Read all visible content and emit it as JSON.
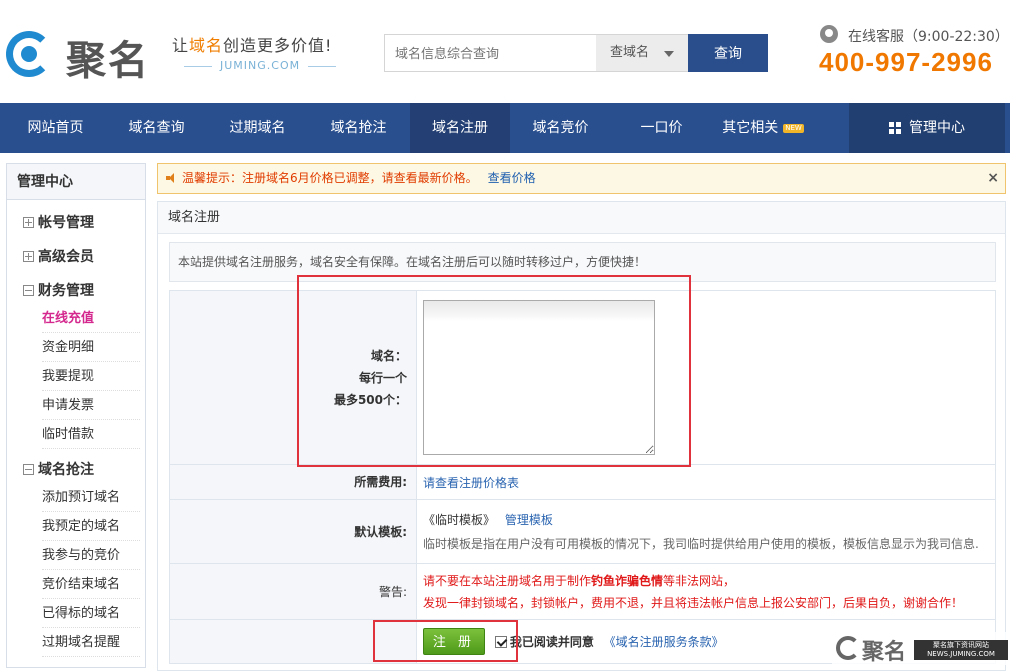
{
  "header": {
    "logo_text": "聚名",
    "slogan_prefix": "让",
    "slogan_highlight": "域名",
    "slogan_suffix": "创造更多价值!",
    "site": "JUMING.COM",
    "search_placeholder": "域名信息综合查询",
    "search_type": "查域名",
    "search_button": "查询",
    "service_text": "在线客服（9:00-22:30）",
    "phone": "400-997-2996"
  },
  "nav": {
    "items": [
      "网站首页",
      "域名查询",
      "过期域名",
      "域名抢注",
      "域名注册",
      "域名竞价",
      "一口价",
      "其它相关"
    ],
    "new_badge": "NEW",
    "active_index": 4,
    "admin": "管理中心"
  },
  "sidebar": {
    "title": "管理中心",
    "groups": [
      "帐号管理",
      "高级会员",
      "财务管理",
      "域名抢注"
    ],
    "finance_links": [
      "在线充值",
      "资金明细",
      "我要提现",
      "申请发票",
      "临时借款"
    ],
    "snipe_links": [
      "添加预订域名",
      "我预定的域名",
      "我参与的竞价",
      "竞价结束域名",
      "已得标的域名",
      "过期域名提醒"
    ]
  },
  "notice": {
    "text": "温馨提示：注册域名6月价格已调整，请查看最新价格。",
    "link": "查看价格",
    "close": "×"
  },
  "panel": {
    "title": "域名注册",
    "intro": "本站提供域名注册服务，域名安全有保障。在域名注册后可以随时转移过户，方便快捷！",
    "domain_label": [
      "域名：",
      "每行一个",
      "最多500个："
    ],
    "fee_label": "所需费用:",
    "fee_link": "请查看注册价格表",
    "template_label": "默认模板:",
    "template_current": "《临时模板》",
    "template_manage": "管理模板",
    "template_note": "临时模板是指在用户没有可用模板的情况下，我司临时提供给用户使用的模板，模板信息显示为我司信息.",
    "warning_label": "警告:",
    "warning_1_pre": "请不要在本站注册域名用于制作",
    "warning_1_bold": "钓鱼诈骗色情",
    "warning_1_post": "等非法网站，",
    "warning_2": "发现一律封锁域名，封锁帐户，费用不退，并且将违法帐户信息上报公安部门，后果自负，谢谢合作！",
    "register_button": "注 册",
    "agree_checked": true,
    "agree_text": "我已阅读并同意",
    "terms_link": "《域名注册服务条款》"
  },
  "watermark": {
    "name": "聚名",
    "tag_1": "聚名旗下资讯网站",
    "tag_2": "NEWS.JUMING.COM"
  },
  "colors": {
    "nav_bg": "#2a4f8f",
    "accent_orange": "#f07800",
    "highlight_red": "#e0323d",
    "link_blue": "#2a64b0"
  }
}
